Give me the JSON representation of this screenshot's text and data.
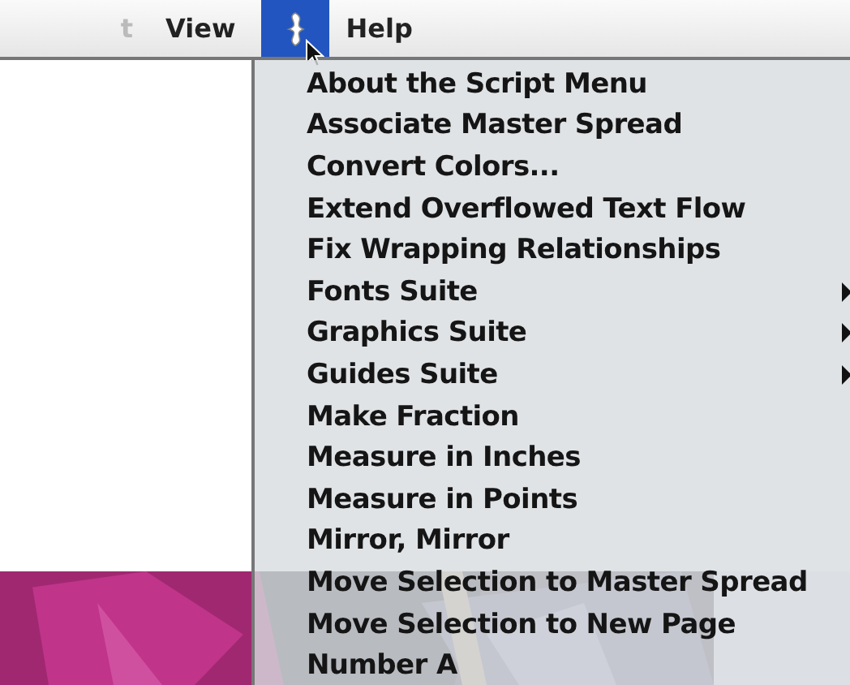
{
  "menu_bar": [
    {
      "label": "t",
      "kind": "text",
      "selected": false
    },
    {
      "label": "View",
      "kind": "text",
      "selected": false
    },
    {
      "kind": "script",
      "selected": true
    },
    {
      "label": "Help",
      "kind": "text",
      "selected": false
    }
  ],
  "menu": {
    "items": [
      {
        "label": "About the Script Menu",
        "submenu": false
      },
      {
        "label": "Associate Master Spread",
        "submenu": false
      },
      {
        "label": "Convert Colors...",
        "submenu": false
      },
      {
        "label": "Extend Overflowed Text Flow",
        "submenu": false
      },
      {
        "label": "Fix Wrapping Relationships",
        "submenu": false
      },
      {
        "label": "Fonts Suite",
        "submenu": true
      },
      {
        "label": "Graphics Suite",
        "submenu": true
      },
      {
        "label": "Guides Suite",
        "submenu": true
      },
      {
        "label": "Make Fraction",
        "submenu": false
      },
      {
        "label": "Measure in Inches",
        "submenu": false
      },
      {
        "label": "Measure in Points",
        "submenu": false
      },
      {
        "label": "Mirror, Mirror",
        "submenu": false
      },
      {
        "label": "Move Selection to Master Spread",
        "submenu": false
      },
      {
        "label": "Move Selection to New Page",
        "submenu": false
      },
      {
        "label": "Number A",
        "submenu": false
      }
    ]
  }
}
